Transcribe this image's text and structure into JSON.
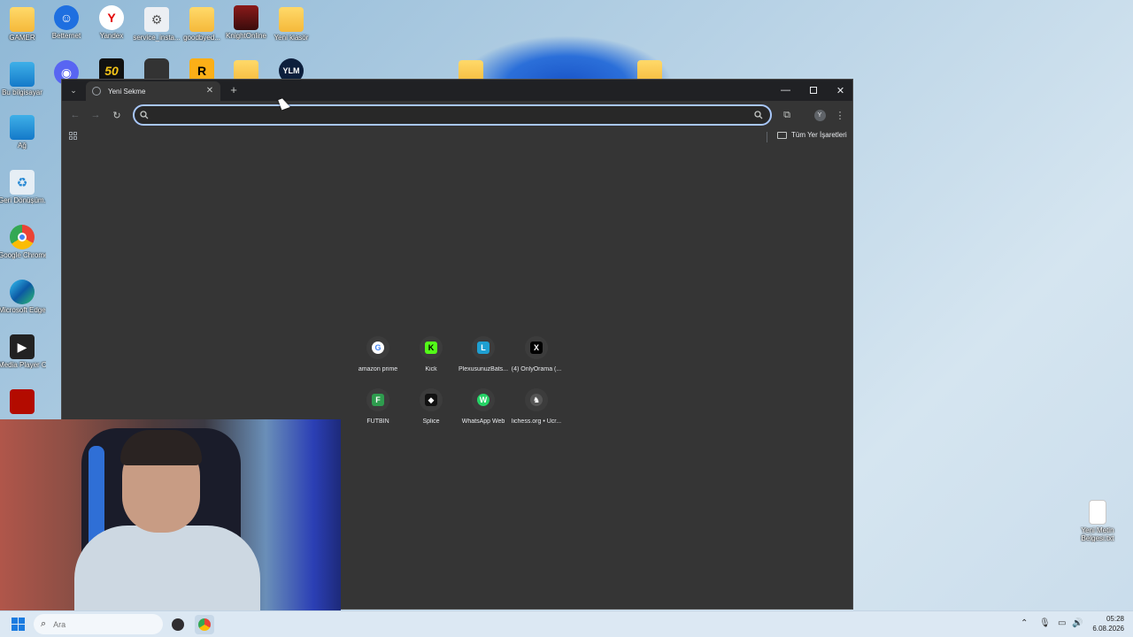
{
  "desktop": {
    "icons": [
      {
        "label": "GAMER",
        "icon": "folder-icon"
      },
      {
        "label": "Betternet",
        "icon": "betternet-icon"
      },
      {
        "label": "Yandex",
        "icon": "yandex-icon"
      },
      {
        "label": "service_insta...",
        "icon": "settings-file-icon"
      },
      {
        "label": "goodbyed...",
        "icon": "folder-icon"
      },
      {
        "label": "KnightOnline",
        "icon": "game-icon"
      },
      {
        "label": "Yeni klasör",
        "icon": "folder-icon"
      },
      {
        "label": "Bu bilgisayar",
        "icon": "computer-icon"
      },
      {
        "label": "Ağ",
        "icon": "network-icon"
      },
      {
        "label": "Geri Dönüşüm...",
        "icon": "recycle-bin-icon"
      },
      {
        "label": "Google Chrome",
        "icon": "chrome-icon"
      },
      {
        "label": "Microsoft Edge",
        "icon": "edge-icon"
      },
      {
        "label": "Media Player Classic",
        "icon": "media-player-icon"
      },
      {
        "label": "Yeni Metin Belgesi.txt",
        "icon": "text-file-icon"
      }
    ],
    "row2_glyphs": {
      "fifty": "50",
      "r": "R",
      "ylm": "YLM"
    }
  },
  "browser": {
    "tab_title": "Yeni Sekme",
    "omnibox_placeholder": "",
    "bookmarks_all": "Tüm Yer İşaretleri",
    "profile_initial": "Y",
    "shortcuts": [
      {
        "label": "amazon prime",
        "glyph": "G",
        "color": "#ffffff"
      },
      {
        "label": "Kick",
        "glyph": "K",
        "color": "#53fc18"
      },
      {
        "label": "PlexusunuzBats...",
        "glyph": "L",
        "color": "#1e9fd1"
      },
      {
        "label": "(4) OnlyOrama (...",
        "glyph": "X",
        "color": "#000000"
      },
      {
        "label": "FUTBIN",
        "glyph": "F",
        "color": "#2e9c4e"
      },
      {
        "label": "Splice",
        "glyph": "◆",
        "color": "#111111"
      },
      {
        "label": "WhatsApp Web",
        "glyph": "W",
        "color": "#25d366"
      },
      {
        "label": "lichess.org • Ücr...",
        "glyph": "♞",
        "color": "#555555"
      }
    ]
  },
  "taskbar": {
    "search_placeholder": "Ara",
    "time": "05:28",
    "date": "6.08.2026"
  }
}
